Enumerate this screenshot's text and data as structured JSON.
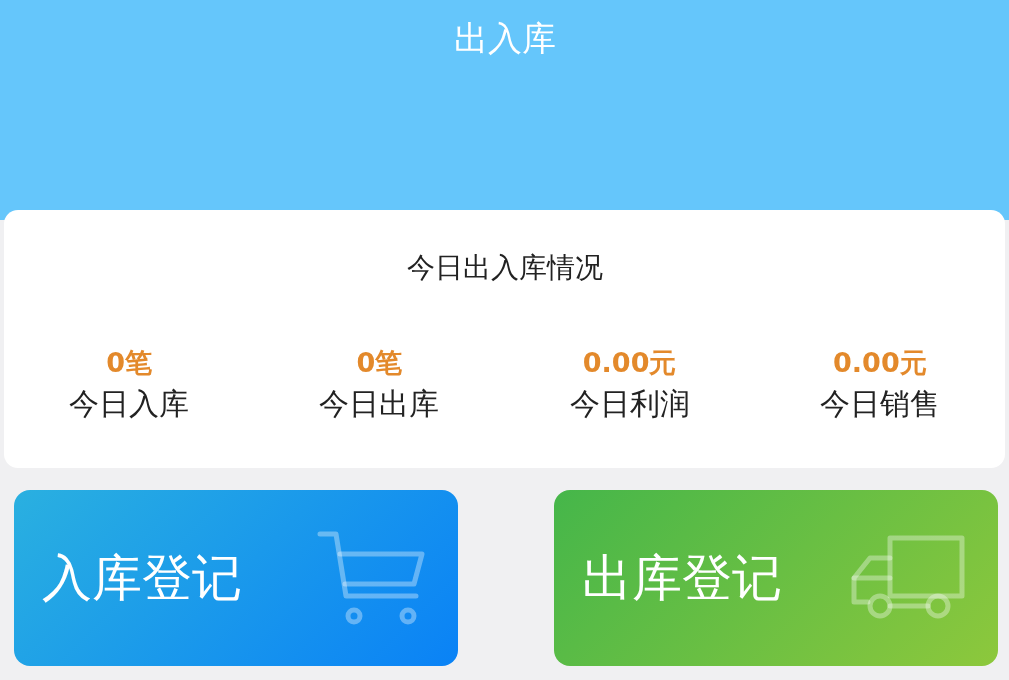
{
  "header": {
    "title": "出入库"
  },
  "summary": {
    "title": "今日出入库情况",
    "stats": [
      {
        "value": "0笔",
        "label": "今日入库"
      },
      {
        "value": "0笔",
        "label": "今日出库"
      },
      {
        "value": "0.00元",
        "label": "今日利润"
      },
      {
        "value": "0.00元",
        "label": "今日销售"
      }
    ]
  },
  "actions": [
    {
      "kind": "inbound",
      "label": "入库登记"
    },
    {
      "kind": "outbound",
      "label": "出库登记"
    }
  ]
}
